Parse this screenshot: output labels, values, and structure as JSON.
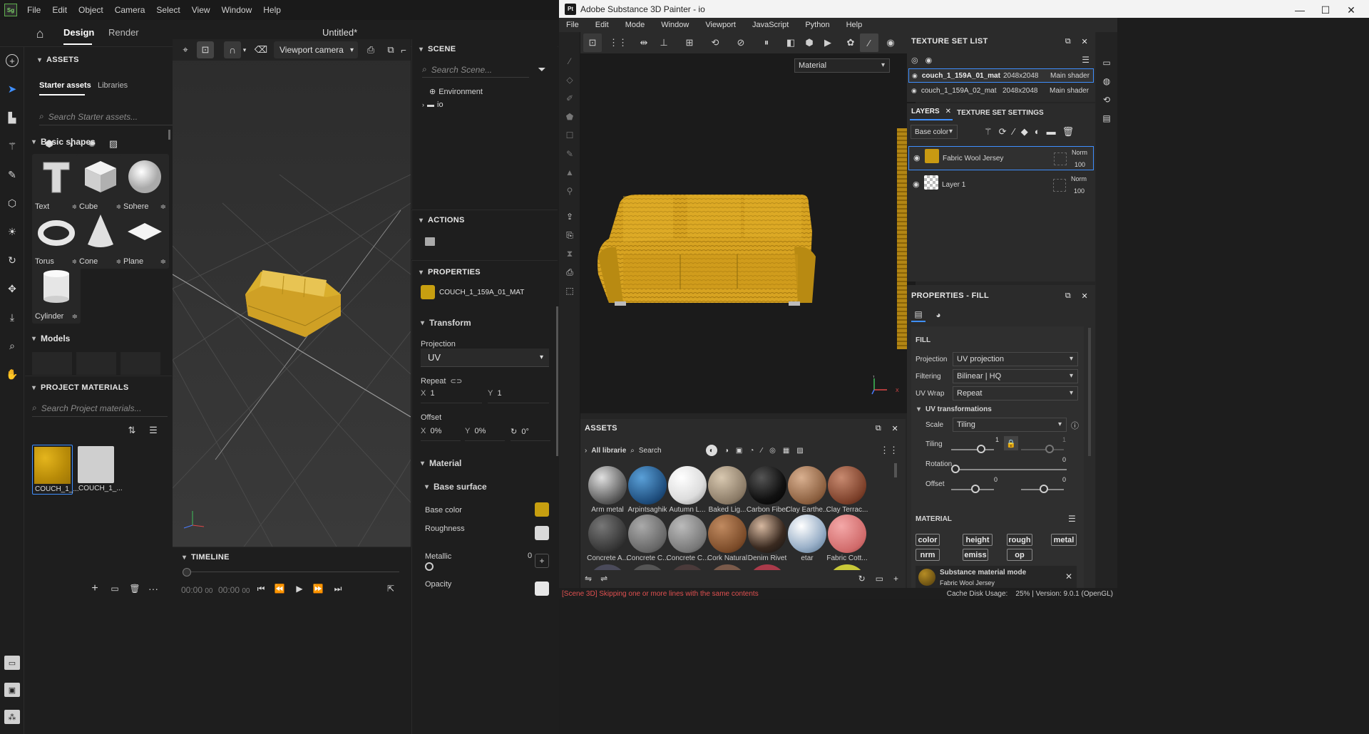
{
  "stager": {
    "menu": [
      "File",
      "Edit",
      "Object",
      "Camera",
      "Select",
      "View",
      "Window",
      "Help"
    ],
    "tabs": {
      "design": "Design",
      "render": "Render"
    },
    "doc_title": "Untitled*",
    "viewport": {
      "camera": "Viewport camera"
    },
    "assets": {
      "header": "ASSETS",
      "tab_starter": "Starter assets",
      "tab_libraries": "Libraries",
      "search_placeholder": "Search Starter assets...",
      "basic_shapes_title": "Basic shapes",
      "shapes": [
        "Text",
        "Cube",
        "Sphere",
        "Torus",
        "Cone",
        "Plane",
        "Cylinder"
      ],
      "models_title": "Models"
    },
    "project_materials": {
      "header": "PROJECT MATERIALS",
      "search_placeholder": "Search Project materials...",
      "items": [
        "COUCH_1_...",
        "COUCH_1_..."
      ]
    },
    "scene": {
      "header": "SCENE",
      "search_placeholder": "Search Scene...",
      "items": [
        "Environment",
        "io"
      ]
    },
    "actions": {
      "header": "ACTIONS"
    },
    "properties": {
      "header": "PROPERTIES",
      "material_name": "COUCH_1_159A_01_MAT",
      "transform": "Transform",
      "projection_label": "Projection",
      "projection_value": "UV",
      "repeat_label": "Repeat",
      "x_label": "X",
      "x_value": "1",
      "y_label": "Y",
      "y_value": "1",
      "offset_label": "Offset",
      "offx": "0%",
      "offy": "0%",
      "rot": "0°",
      "material_title": "Material",
      "base_surface": "Base surface",
      "base_color": "Base color",
      "roughness": "Roughness",
      "metallic": "Metallic",
      "metallic_value": "0",
      "opacity": "Opacity"
    },
    "timeline": {
      "header": "TIMELINE",
      "t1": "00:00",
      "t1f": "00",
      "t2": "00:00",
      "t2f": "00"
    }
  },
  "painter": {
    "title": "Adobe Substance 3D Painter - io",
    "menu": [
      "File",
      "Edit",
      "Mode",
      "Window",
      "Viewport",
      "JavaScript",
      "Python",
      "Help"
    ],
    "viewport_mode": "Material",
    "texture_set_list": {
      "header": "TEXTURE SET LIST",
      "rows": [
        {
          "name": "couch_1_159A_01_mat",
          "res": "2048x2048",
          "shader": "Main shader"
        },
        {
          "name": "couch_1_159A_02_mat",
          "res": "2048x2048",
          "shader": "Main shader"
        }
      ]
    },
    "layers": {
      "tab_layers": "LAYERS",
      "tab_settings": "TEXTURE SET SETTINGS",
      "channel": "Base color",
      "items": [
        {
          "name": "Fabric Wool Jersey",
          "blend": "Norm",
          "opacity": "100"
        },
        {
          "name": "Layer 1",
          "blend": "Norm",
          "opacity": "100"
        }
      ]
    },
    "properties_fill": {
      "header": "PROPERTIES - FILL",
      "fill": "FILL",
      "projection_label": "Projection",
      "projection": "UV projection",
      "filtering_label": "Filtering",
      "filtering": "Bilinear | HQ",
      "uvwrap_label": "UV Wrap",
      "uvwrap": "Repeat",
      "uvt_title": "UV transformations",
      "scale_label": "Scale",
      "scale": "Tiling",
      "tiling_label": "Tiling",
      "tiling_a": "1",
      "tiling_b": "1",
      "rotation_label": "Rotation",
      "rotation_value": "0",
      "offset_label": "Offset",
      "offset_a": "0",
      "offset_b": "0",
      "material_title": "MATERIAL",
      "chips": [
        "color",
        "height",
        "rough",
        "metal",
        "nrm",
        "emiss",
        "op"
      ],
      "mode_title": "Substance material mode",
      "mode_sub": "Fabric Wool Jersey"
    },
    "assets": {
      "header": "ASSETS",
      "library": "All librarie",
      "search": "Search",
      "row1": [
        "Arm metal",
        "Arpintsaghik",
        "Autumn L...",
        "Baked Lig...",
        "Carbon Fiber",
        "Clay Earthe...",
        "Clay Terrac..."
      ],
      "row2": [
        "Concrete A...",
        "Concrete C...",
        "Concrete C...",
        "Cork Natural",
        "Denim Rivet",
        "etar",
        "Fabric Cott..."
      ]
    },
    "axis": {
      "y": "Y",
      "x": "X"
    },
    "status_left": "[Scene 3D] Skipping one or more lines with the same contents",
    "status_right": "Cache Disk Usage:    25% | Version: 9.0.1 (OpenGL)"
  }
}
